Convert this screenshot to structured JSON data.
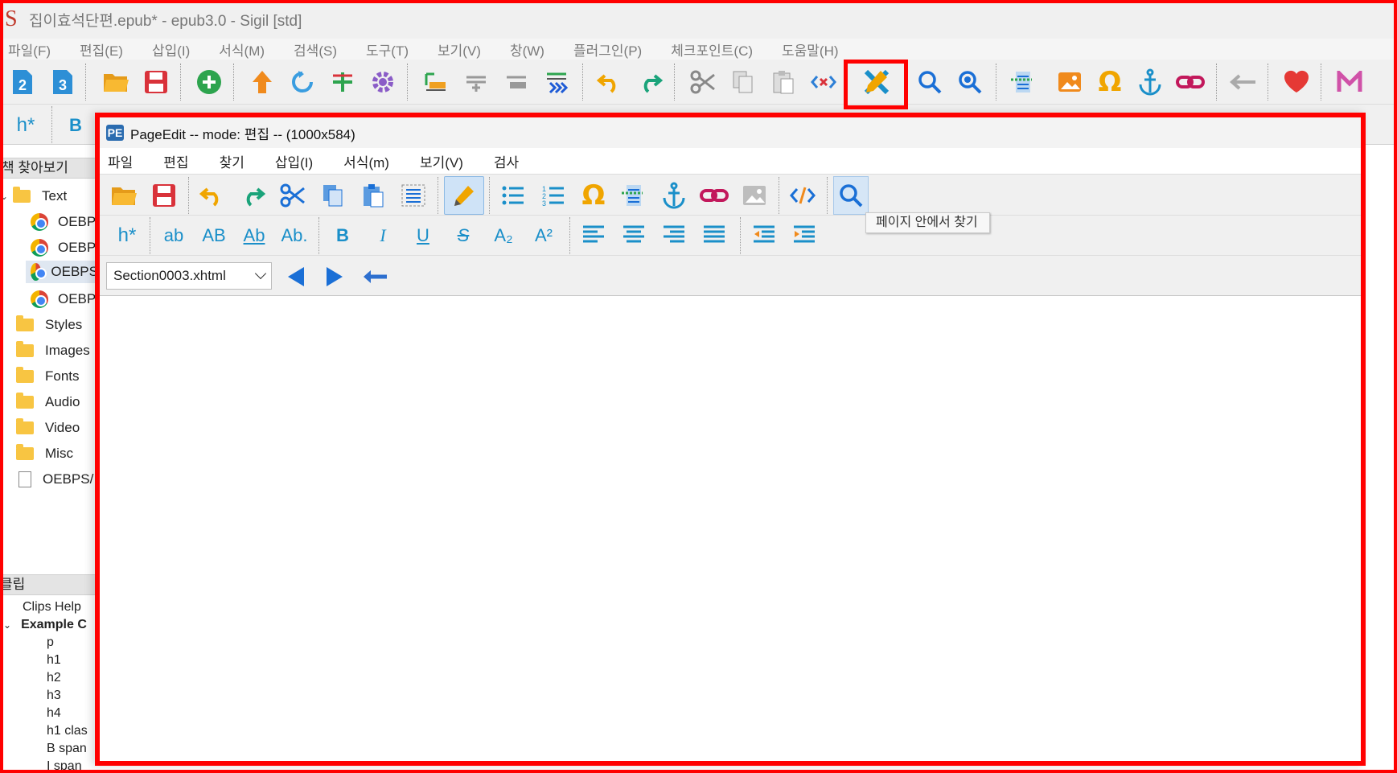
{
  "window": {
    "title": "집이효석단편.epub* - epub3.0 - Sigil [std]",
    "logo_glyph": "S"
  },
  "menubar": [
    "파일(F)",
    "편집(E)",
    "삽입(I)",
    "서식(M)",
    "검색(S)",
    "도구(T)",
    "보기(V)",
    "창(W)",
    "플러그인(P)",
    "체크포인트(C)",
    "도움말(H)"
  ],
  "main_toolbar": {
    "icons": [
      "h2-icon",
      "h3-icon",
      "open-folder-icon",
      "save-icon",
      "add-icon",
      "upload-icon",
      "refresh-icon",
      "plus-split-icon",
      "settings-icon",
      "insert-marker-icon",
      "split-icon",
      "merge-icon",
      "generate-toc-icon",
      "undo-icon",
      "redo-icon",
      "cut-icon",
      "copy-icon",
      "paste-icon",
      "code-tag-icon",
      "pageedit-icon",
      "search-icon",
      "search-zoom-icon",
      "metadata-icon",
      "image-icon",
      "omega-icon",
      "anchor-icon",
      "link-icon",
      "back-icon",
      "heart-icon",
      "m-logo-icon"
    ],
    "h2_label": "2",
    "h3_label": "3"
  },
  "second_toolbar": {
    "heading_label": "h*",
    "bold_label": "B"
  },
  "book_browser": {
    "title": "책 찾아보기",
    "items": [
      {
        "label": "Text",
        "type": "folder",
        "expanded": true
      },
      {
        "label": "OEBPS",
        "type": "chrome"
      },
      {
        "label": "OEBPS",
        "type": "chrome"
      },
      {
        "label": "OEBPS",
        "type": "chrome",
        "selected": true
      },
      {
        "label": "OEBPS",
        "type": "chrome"
      },
      {
        "label": "Styles",
        "type": "folder"
      },
      {
        "label": "Images",
        "type": "folder"
      },
      {
        "label": "Fonts",
        "type": "folder"
      },
      {
        "label": "Audio",
        "type": "folder"
      },
      {
        "label": "Video",
        "type": "folder"
      },
      {
        "label": "Misc",
        "type": "folder"
      },
      {
        "label": "OEBPS/",
        "type": "file"
      }
    ]
  },
  "clips": {
    "title": "클립",
    "items": [
      "Clips Help",
      "Example C",
      "p",
      "h1",
      "h2",
      "h3",
      "h4",
      "h1 clas",
      "B span",
      "I span"
    ]
  },
  "pageedit": {
    "title": "PageEdit -- mode: 편집 -- (1000x584)",
    "logo_glyph": "PE",
    "menu": [
      "파일",
      "편집",
      "찾기",
      "삽입(I)",
      "서식(m)",
      "보기(V)",
      "검사"
    ],
    "toolbar2_labels": {
      "heading": "h*",
      "lower": "ab",
      "upper": "AB",
      "title": "Ab",
      "sentence": "Ab.",
      "bold": "B",
      "italic": "I",
      "underline": "U",
      "strike": "S",
      "sub": "A₂",
      "sup": "A²"
    },
    "file_select": "Section0003.xhtml",
    "tooltip": "페이지 안에서 찾기"
  },
  "colors": {
    "highlight": "#ff0000",
    "accent": "#1a8fc9",
    "menu_gray": "#7a7a7a"
  }
}
